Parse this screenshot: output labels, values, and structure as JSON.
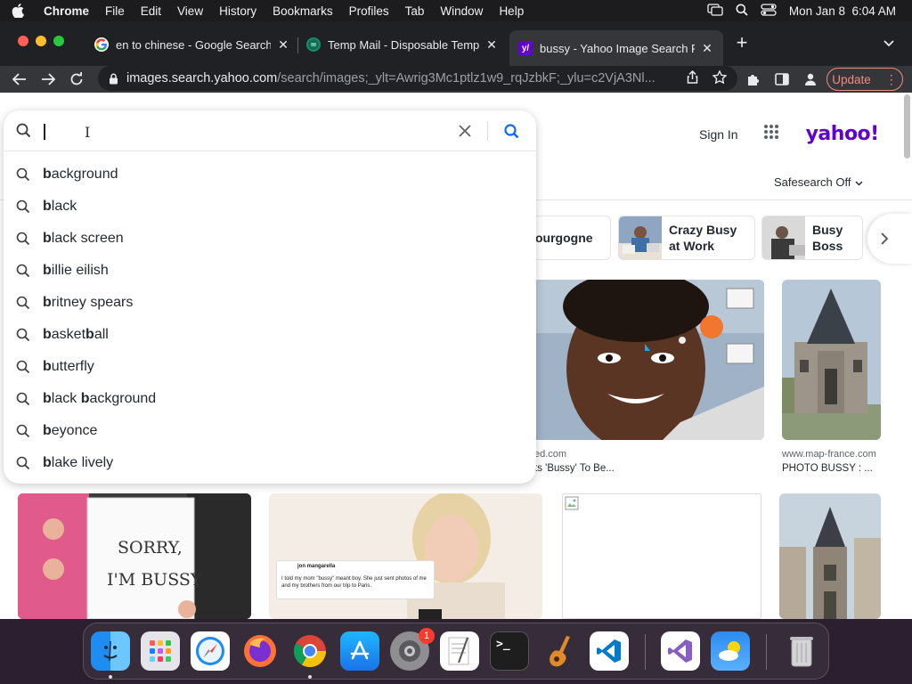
{
  "menubar": {
    "app_name": "Chrome",
    "items": [
      "File",
      "Edit",
      "View",
      "History",
      "Bookmarks",
      "Profiles",
      "Tab",
      "Window",
      "Help"
    ],
    "clock": "Mon Jan 8  6:04 AM"
  },
  "tabs": [
    {
      "title": "en to chinese - Google Search",
      "favicon": "google-icon",
      "active": false
    },
    {
      "title": "Temp Mail - Disposable Tempo",
      "favicon": "temp-mail-icon",
      "active": false
    },
    {
      "title": "bussy - Yahoo Image Search R",
      "favicon": "yahoo-icon",
      "active": true
    }
  ],
  "toolbar": {
    "url_host": "images.search.yahoo.com",
    "url_path": "/search/images;_ylt=Awrig3Mc1ptlz1w9_rqJzbkF;_ylu=c2VjA3Nl...",
    "update_label": "Update"
  },
  "header": {
    "sign_in": "Sign In",
    "logo": "yahoo!",
    "safesearch": "Safesearch Off"
  },
  "search": {
    "query": "",
    "suggestions": [
      {
        "bold": "b",
        "rest": "ackground"
      },
      {
        "bold": "b",
        "rest": "lack"
      },
      {
        "bold": "b",
        "rest": "lack screen"
      },
      {
        "bold": "b",
        "rest": "illie eilish"
      },
      {
        "bold": "b",
        "rest": "ritney spears"
      },
      {
        "bold": "b",
        "rest": "asket",
        "bold2": "b",
        "rest2": "all"
      },
      {
        "bold": "b",
        "rest": "utterfly"
      },
      {
        "bold": "b",
        "rest": "lack ",
        "bold2": "b",
        "rest2": "ackground"
      },
      {
        "bold": "b",
        "rest": "eyonce"
      },
      {
        "bold": "b",
        "rest": "lake lively"
      }
    ]
  },
  "related": [
    {
      "label": "ourgogne"
    },
    {
      "label": "Crazy Busy at Work"
    },
    {
      "label": "Busy Boss"
    }
  ],
  "results": {
    "card1_source": "ed.com",
    "card1_title": "ts 'Bussy' To Be...",
    "card2_source": "www.map-france.com",
    "card2_title": "PHOTO BUSSY : ...",
    "notebook_text_1": "SORRY,",
    "notebook_text_2": "I'M BUSSY",
    "tweet_name": "jon mangarella",
    "tweet_text": "I told my mom \"bussy\" meant boy. She just sent photos of me and my brothers from our trip to Paris."
  },
  "dock": {
    "settings_badge": "1"
  },
  "colors": {
    "yahoo_purple": "#6001d2",
    "search_blue": "#0f69ff",
    "update_red": "#f28b82"
  }
}
